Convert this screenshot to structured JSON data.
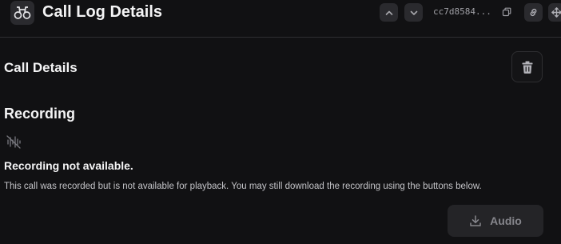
{
  "header": {
    "logo_icon": "binoculars-icon",
    "title": "Call Log Details",
    "nav_up_icon": "chevron-up-icon",
    "nav_down_icon": "chevron-down-icon",
    "call_id": "cc7d8584...",
    "copy_icon": "copy-icon",
    "link_icon": "link-icon",
    "expand_icon": "expand-icon"
  },
  "details": {
    "title": "Call Details",
    "delete_icon": "trash-icon"
  },
  "recording": {
    "title": "Recording",
    "unavailable_icon": "audio-waveform-off-icon",
    "message_title": "Recording not available.",
    "message_body": "This call was recorded but is not available for playback. You may still download the recording using the buttons below.",
    "download_audio_label": "Audio",
    "download_icon": "download-icon"
  },
  "colors": {
    "background": "#111113",
    "surface": "#2a2a2e",
    "border": "#2e2e31",
    "text": "#f4f4f5",
    "muted_text": "#86868c"
  }
}
